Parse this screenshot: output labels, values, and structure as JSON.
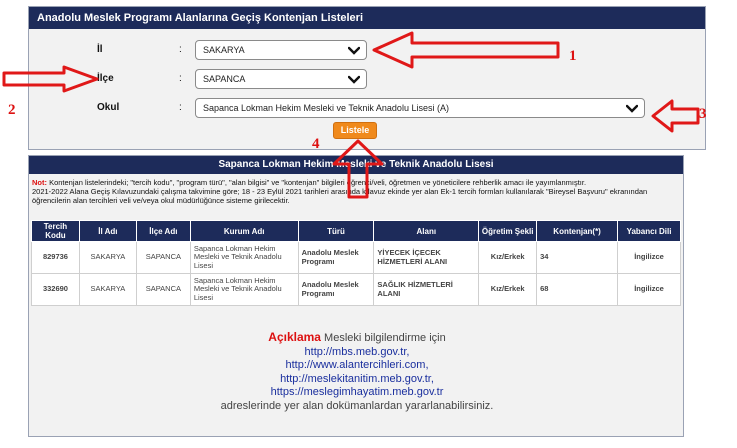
{
  "form": {
    "title": "Anadolu Meslek Programı Alanlarına Geçiş Kontenjan Listeleri",
    "il_label": "İl",
    "ilce_label": "İlçe",
    "okul_label": "Okul",
    "colon": ":",
    "il_value": "SAKARYA",
    "ilce_value": "SAPANCA",
    "okul_value": "Sapanca Lokman Hekim Mesleki ve Teknik Anadolu Lisesi (A)",
    "listele_label": "Listele"
  },
  "result": {
    "title": "Sapanca Lokman Hekim Mesleki ve Teknik Anadolu Lisesi",
    "note_label": "Not:",
    "note_text": " Kontenjan listelerindeki; \"tercih kodu\", \"program türü\", \"alan bilgisi\" ve \"kontenjan\" bilgileri öğrenci/veli, öğretmen ve yöneticilere rehberlik amacı ile yayımlanmıştır.",
    "note_line2": "2021-2022 Alana Geçiş Kılavuzundaki çalışma takvimine göre; 18 - 23 Eylül 2021 tarihleri arasında kılavuz ekinde yer alan Ek-1 tercih formları kullanılarak \"Bireysel Başvuru\" ekranından öğrencilerin alan tercihleri veli ve/veya okul müdürlüğünce sisteme girilecektir.",
    "columns": [
      "Tercih Kodu",
      "İl Adı",
      "İlçe Adı",
      "Kurum Adı",
      "Türü",
      "Alanı",
      "Öğretim Şekli",
      "Kontenjan(*)",
      "Yabancı Dili"
    ],
    "rows": [
      {
        "kod": "829736",
        "il": "SAKARYA",
        "ilce": "SAPANCA",
        "kurum": "Sapanca Lokman Hekim Mesleki ve Teknik Anadolu Lisesi",
        "tur": "Anadolu Meslek Programı",
        "alan": "YİYECEK İÇECEK HİZMETLERİ ALANI",
        "ogretim": "Kız/Erkek",
        "kontenjan": "34",
        "dil": "İngilizce"
      },
      {
        "kod": "332690",
        "il": "SAKARYA",
        "ilce": "SAPANCA",
        "kurum": "Sapanca Lokman Hekim Mesleki ve Teknik Anadolu Lisesi",
        "tur": "Anadolu Meslek Programı",
        "alan": "SAĞLIK HİZMETLERİ ALANI",
        "ogretim": "Kız/Erkek",
        "kontenjan": "68",
        "dil": "İngilizce"
      }
    ],
    "aciklama_heading": "Açıklama",
    "aciklama_intro": " Mesleki bilgilendirme için",
    "links": [
      "http://mbs.meb.gov.tr,",
      "http://www.alantercihleri.com,",
      "http://meslekitanitim.meb.gov.tr,",
      "https://meslegimhayatim.meb.gov.tr"
    ],
    "aciklama_outro": "adreslerinde yer alan dokümanlardan yararlanabilirsiniz."
  },
  "annotations": {
    "n1": "1",
    "n2": "2",
    "n3": "3",
    "n4": "4",
    "color": "#e01818"
  },
  "colors": {
    "header_bg": "#1d2b5a",
    "button_bg": "#f08a1c",
    "accent_red": "#d11111",
    "link_blue": "#1f3fd0"
  }
}
